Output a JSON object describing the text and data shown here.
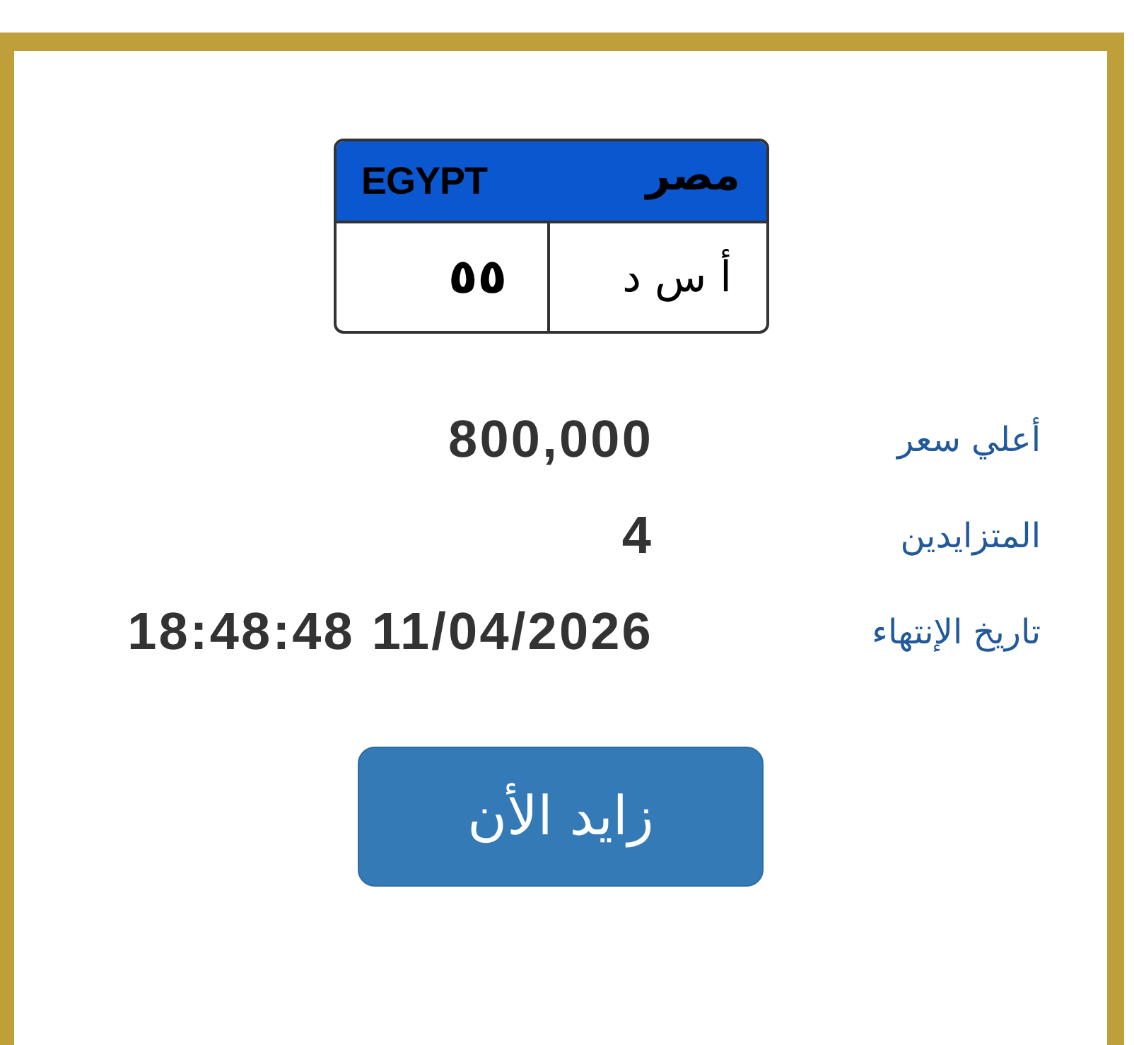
{
  "plate": {
    "country_latin": "EGYPT",
    "country_arabic": "مصر",
    "number": "٥٥",
    "letters": "أ س د"
  },
  "details": [
    {
      "label": "أعلي سعر",
      "value": "800,000"
    },
    {
      "label": "المتزايدين",
      "value": "4"
    },
    {
      "label": "تاريخ الإنتهاء",
      "value": "18:48:48 11/04/2026"
    }
  ],
  "bid_button": {
    "label": "زايد الأن"
  }
}
